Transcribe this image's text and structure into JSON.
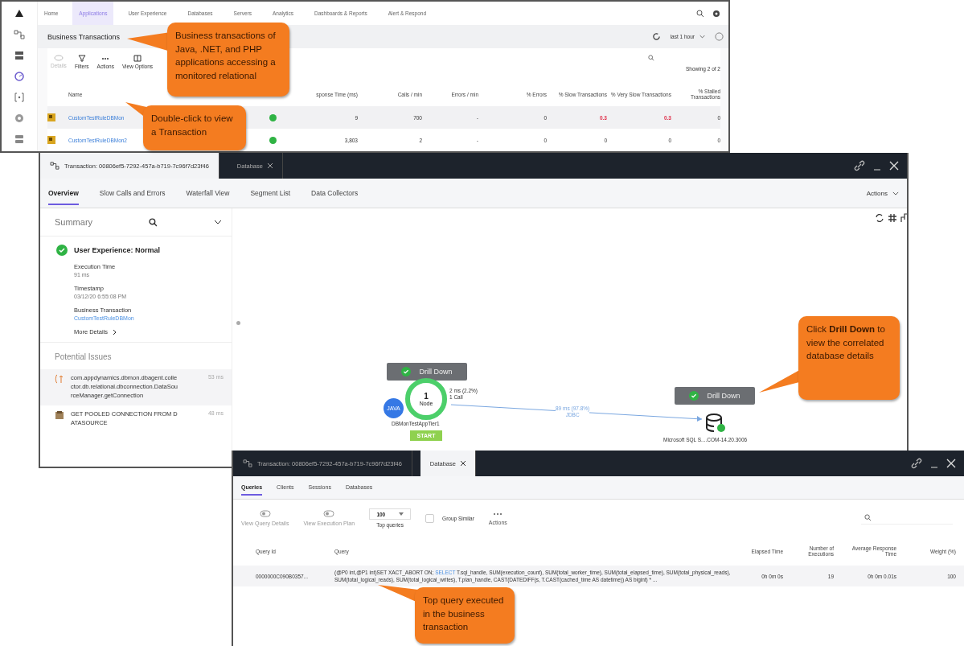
{
  "main_window": {
    "nav": [
      {
        "label": "Home",
        "selected": false
      },
      {
        "label": "Applications",
        "selected": true
      },
      {
        "label": "User Experience",
        "selected": false
      },
      {
        "label": "Databases",
        "selected": false
      },
      {
        "label": "Servers",
        "selected": false
      },
      {
        "label": "Analytics",
        "selected": false
      },
      {
        "label": "Dashboards & Reports",
        "selected": false
      },
      {
        "label": "Alert & Respond",
        "selected": false
      }
    ],
    "page_title": "Business Transactions",
    "time_range": "last 1 hour",
    "toolbar": [
      {
        "label": "Details",
        "kind": "eye",
        "disabled": true
      },
      {
        "label": "Filters",
        "kind": "filter",
        "disabled": false
      },
      {
        "label": "Actions",
        "kind": "more",
        "disabled": false
      },
      {
        "label": "View Options",
        "kind": "columns",
        "disabled": false
      }
    ],
    "showing": "Showing 2 of 2",
    "columns": [
      "Name",
      "sponse Time (ms)",
      "Calls / min",
      "Errors / min",
      "% Errors",
      "% Slow Transactions",
      "% Very Slow Transactions",
      "% Stalled Transactions"
    ],
    "rows": [
      {
        "cells": [
          {
            "text": "CustomTestRuleDBMon",
            "alert": false
          },
          {
            "text": "9",
            "alert": false
          },
          {
            "text": "700",
            "alert": false
          },
          {
            "text": "-"
          },
          {
            "text": "0",
            "alert": false
          },
          {
            "text": "0.3",
            "alert": true
          },
          {
            "text": "0.3",
            "alert": true
          },
          {
            "text": "0",
            "alert": false
          }
        ]
      },
      {
        "cells": [
          {
            "text": "CustomTestRuleDBMon2",
            "alert": false
          },
          {
            "text": "3,803",
            "alert": false
          },
          {
            "text": "2",
            "alert": false
          },
          {
            "text": "-"
          },
          {
            "text": "0",
            "alert": false
          },
          {
            "text": "0",
            "alert": false
          },
          {
            "text": "0",
            "alert": false
          },
          {
            "text": "0",
            "alert": false
          }
        ]
      }
    ]
  },
  "transaction_window": {
    "window_tabs": [
      {
        "label": "Transaction: 00806ef5-7292-457a-b719-7c96f7d23f46",
        "selected": true,
        "closable": false
      },
      {
        "label": "Database",
        "selected": false,
        "closable": true
      }
    ],
    "tabs": [
      {
        "label": "Overview",
        "selected": true
      },
      {
        "label": "Slow Calls and Errors",
        "selected": false
      },
      {
        "label": "Waterfall View",
        "selected": false
      },
      {
        "label": "Segment List",
        "selected": false
      },
      {
        "label": "Data Collectors",
        "selected": false
      }
    ],
    "actions": "Actions",
    "summary": {
      "title": "Summary",
      "status": "User Experience: Normal",
      "fields": [
        {
          "label": "Execution Time",
          "value": "91 ms",
          "kind": "text"
        },
        {
          "label": "Timestamp",
          "value": "03/12/20 6:55:08 PM",
          "kind": "text"
        },
        {
          "label": "Business Transaction",
          "value": "CustomTestRuleDBMon",
          "kind": "link"
        }
      ],
      "more": "More Details"
    },
    "issues_title": "Potential Issues",
    "issues": [
      {
        "text": "com.appdynamics.dbmon.dbagent.collector.db.relational.dbconnection.DataSourceManager.getConnection",
        "time": "53 ms",
        "kind": "code"
      },
      {
        "text": "GET POOLED CONNECTION FROM DATASOURCE",
        "time": "48 ms",
        "kind": "db"
      }
    ],
    "flow_map": {
      "drill_down": [
        "Drill Down",
        "Drill Down"
      ],
      "tier_count": "1",
      "tier_unit": "Node",
      "tier_badge": "JAVA",
      "tier_stats": [
        "2 ms (2.2%)",
        "1 Call"
      ],
      "tier_name": "DBMonTestAppTier1",
      "start": "START",
      "edge_labels": [
        "89 ms (97.8%)",
        "JDBC"
      ],
      "db_name": "Microsoft SQL S....COM-14.20.3006"
    }
  },
  "database_window": {
    "window_tabs": [
      {
        "label": "Transaction: 00806ef5-7292-457a-b719-7c96f7d23f46",
        "selected": false,
        "closable": false
      },
      {
        "label": "Database",
        "selected": true,
        "closable": true
      }
    ],
    "tabs": [
      {
        "label": "Queries",
        "selected": true
      },
      {
        "label": "Clients",
        "selected": false
      },
      {
        "label": "Sessions",
        "selected": false
      },
      {
        "label": "Databases",
        "selected": false
      }
    ],
    "toolbar": [
      {
        "kind": "toggle",
        "label": "View Query Details",
        "disabled": true
      },
      {
        "kind": "toggle",
        "label": "View Execution Plan",
        "disabled": true
      },
      {
        "kind": "select",
        "value": "100",
        "label": "Top queries"
      },
      {
        "kind": "checkbox",
        "label": "Group Similar",
        "checked": false
      },
      {
        "kind": "more",
        "label": "Actions"
      }
    ],
    "columns": [
      "Query Id",
      "Query",
      "Elapsed Time",
      "Number of Executions",
      "Average Response Time",
      "Weight (%)"
    ],
    "rows": [
      {
        "query_id": "0000000C090B0357...",
        "query": [
          {
            "text": "(@P0 int,@P1 int)SET XACT_ABORT ON; ",
            "kind": "plain"
          },
          {
            "text": "SELECT",
            "kind": "keyword"
          },
          {
            "text": " T.sql_handle, SUM(execution_count), SUM(total_worker_time), SUM(total_elapsed_time), SUM(total_physical_reads), SUM(total_logical_reads), SUM(total_logical_writes), T.plan_handle, CAST(DATEDIFF(s, T.CAST(cached_time AS datetime)) AS bigint) * ...",
            "kind": "plain"
          }
        ],
        "elapsed": "0h 0m 0s",
        "executions": "19",
        "average": "0h 0m 0.01s",
        "weight": "100"
      }
    ]
  },
  "callouts": [
    "Business transactions of Java, .NET, and PHP applications accessing a monitored relational",
    "Double-click to view a Transaction",
    "Click **Drill Down** to view the correlated database details",
    "Top query executed in the business transaction"
  ]
}
